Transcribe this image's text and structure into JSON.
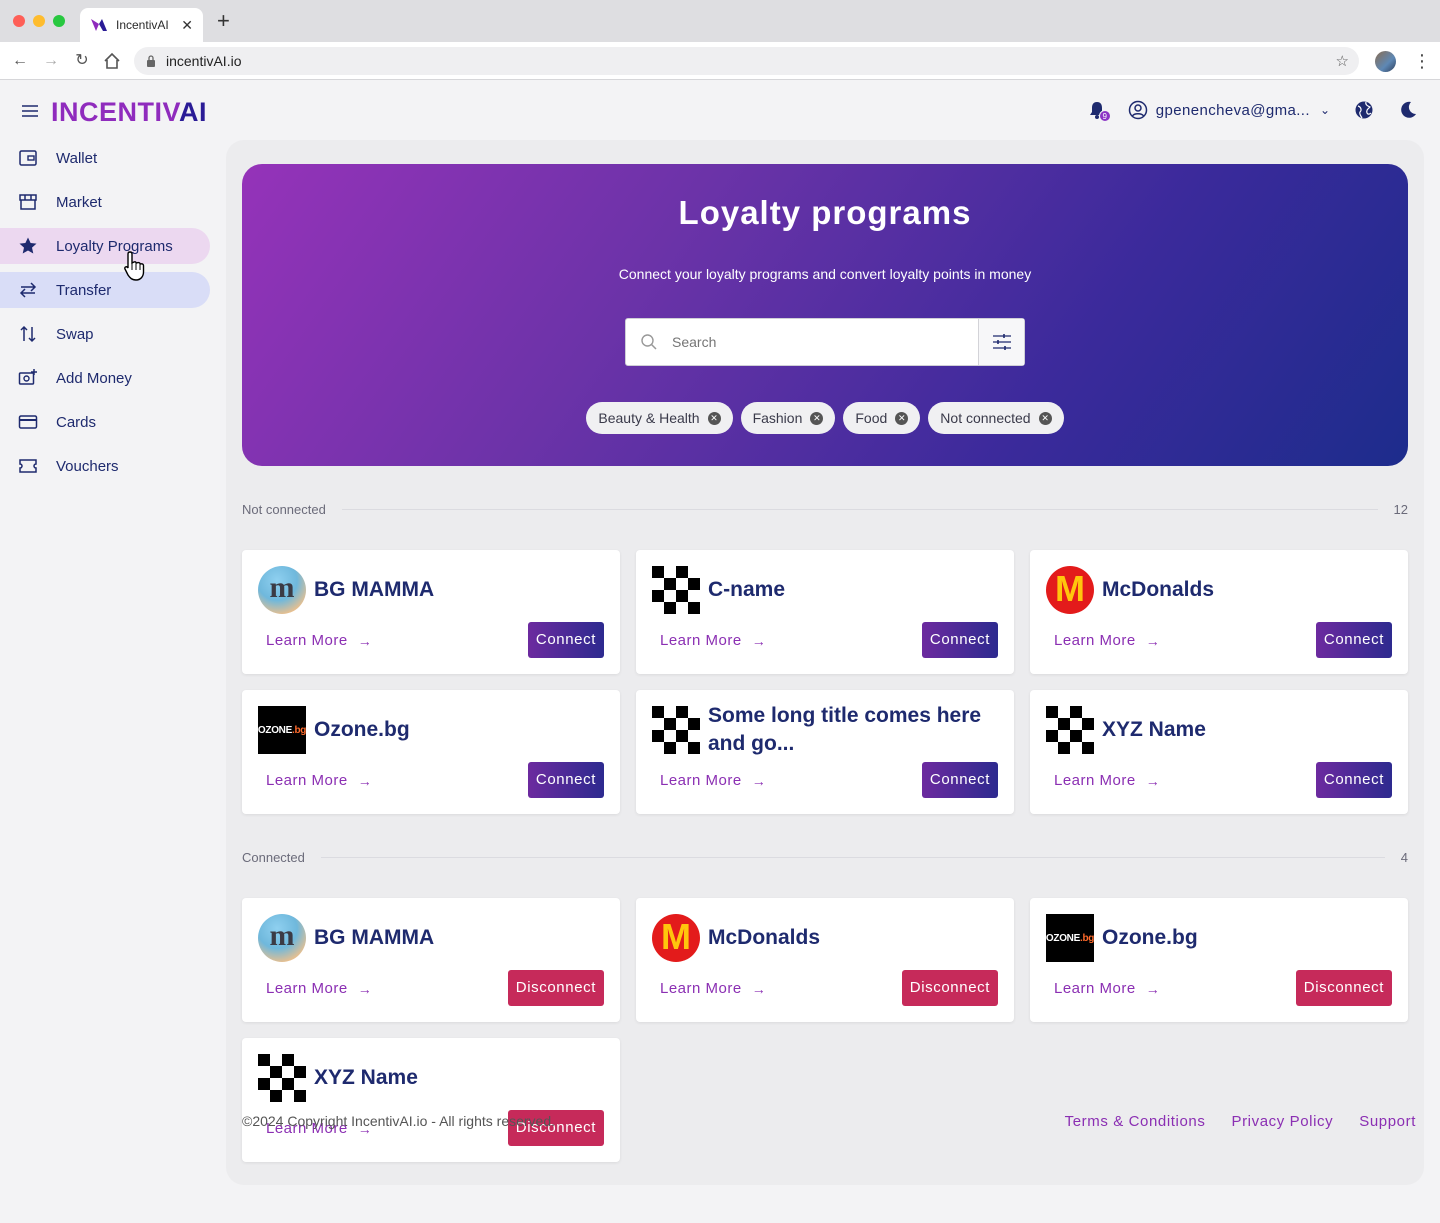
{
  "browser": {
    "tab_title": "IncentivAI",
    "url": "incentivAI.io"
  },
  "header": {
    "logo_main": "INCENTIV",
    "logo_ai": "AI",
    "notification_count": "9",
    "account_email": "gpenencheva@gma..."
  },
  "sidebar": {
    "items": [
      {
        "label": "Wallet",
        "icon": "wallet-icon"
      },
      {
        "label": "Market",
        "icon": "store-icon"
      },
      {
        "label": "Loyalty Programs",
        "icon": "star-icon"
      },
      {
        "label": "Transfer",
        "icon": "transfer-icon"
      },
      {
        "label": "Swap",
        "icon": "swap-icon"
      },
      {
        "label": "Add Money",
        "icon": "add-money-icon"
      },
      {
        "label": "Cards",
        "icon": "card-icon"
      },
      {
        "label": "Vouchers",
        "icon": "voucher-icon"
      }
    ]
  },
  "hero": {
    "title": "Loyalty programs",
    "subtitle": "Connect your loyalty programs and convert loyalty points in money",
    "search_placeholder": "Search",
    "chips": [
      "Beauty & Health",
      "Fashion",
      "Food",
      "Not connected"
    ]
  },
  "not_connected": {
    "label": "Not connected",
    "count": "12",
    "cards": [
      {
        "name": "BG MAMMA",
        "logo": "bgmamma",
        "learn": "Learn More",
        "action": "Connect"
      },
      {
        "name": "C-name",
        "logo": "checker",
        "learn": "Learn More",
        "action": "Connect"
      },
      {
        "name": "McDonalds",
        "logo": "mcdonalds",
        "learn": "Learn More",
        "action": "Connect"
      },
      {
        "name": "Ozone.bg",
        "logo": "ozone",
        "learn": "Learn More",
        "action": "Connect"
      },
      {
        "name": "Some long title comes here and go...",
        "logo": "checker",
        "learn": "Learn More",
        "action": "Connect"
      },
      {
        "name": "XYZ Name",
        "logo": "checker",
        "learn": "Learn More",
        "action": "Connect"
      }
    ]
  },
  "connected": {
    "label": "Connected",
    "count": "4",
    "cards": [
      {
        "name": "BG MAMMA",
        "logo": "bgmamma",
        "learn": "Learn More",
        "action": "Disconnect"
      },
      {
        "name": "McDonalds",
        "logo": "mcdonalds",
        "learn": "Learn More",
        "action": "Disconnect"
      },
      {
        "name": "Ozone.bg",
        "logo": "ozone",
        "learn": "Learn More",
        "action": "Disconnect"
      },
      {
        "name": "XYZ Name",
        "logo": "checker",
        "learn": "Learn More",
        "action": "Disconnect"
      }
    ]
  },
  "footer": {
    "copyright": "©2024 Copyright IncentivAI.io - All rights reserved.",
    "terms": "Terms & Conditions",
    "privacy": "Privacy Policy",
    "support": "Support"
  },
  "colors": {
    "brand_purple": "#8f2bbd",
    "brand_navy": "#1e2a6e",
    "disconnect": "#c62a5a"
  }
}
